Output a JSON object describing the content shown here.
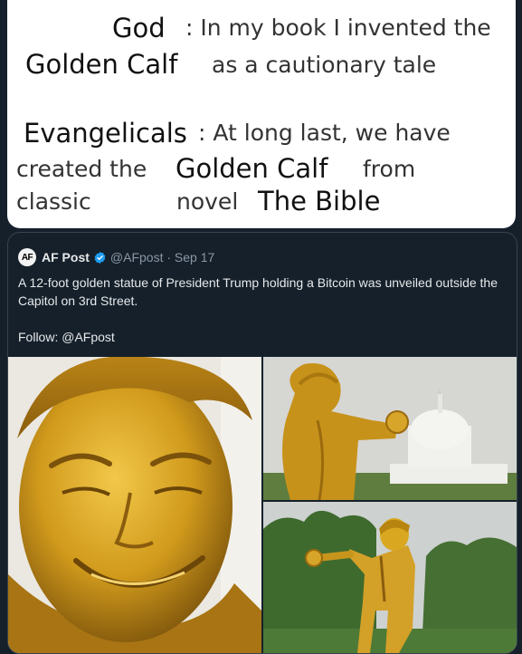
{
  "meme": {
    "god_speaker": "God",
    "god_line1": ": In my book I invented the",
    "golden_calf_1": "Golden Calf",
    "god_line2": "as a cautionary tale",
    "evangelicals_speaker": "Evangelicals",
    "evangelicals_line1": ": At long last, we have",
    "created_the": "created the",
    "golden_calf_2": "Golden Calf",
    "from": "from",
    "classic": "classic",
    "novel": "novel",
    "the_bible": "The Bible"
  },
  "quoted_tweet": {
    "avatar_text": "AF",
    "author_name": "AF Post",
    "handle_date": "@AFpost · Sep 17",
    "body": "A 12-foot golden statue of President Trump holding a Bitcoin was unveiled outside the Capitol on 3rd Street.",
    "follow": "Follow: @AFpost",
    "colors": {
      "verified": "#1d9bf0",
      "statue_gold": "#d9a620"
    }
  }
}
